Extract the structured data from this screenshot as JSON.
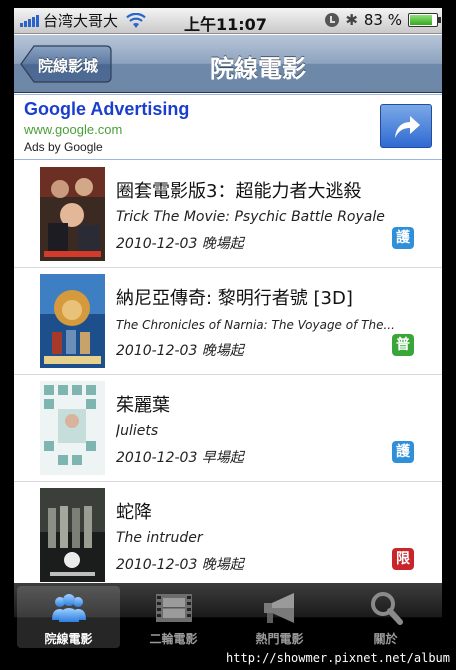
{
  "status_bar": {
    "carrier": "台湾大哥大",
    "time": "上午11:07",
    "battery_percent": "83 %",
    "battery_level": 0.83,
    "icons": [
      "signal-icon",
      "wifi-icon",
      "rotation-lock-icon",
      "bluetooth-icon",
      "battery-icon"
    ]
  },
  "nav": {
    "back_label": "院線影城",
    "title": "院線電影"
  },
  "ad": {
    "title": "Google Advertising",
    "url": "www.google.com",
    "byline": "Ads by Google",
    "button_icon": "share-arrow-icon"
  },
  "movies": [
    {
      "title": "圈套電影版3：超能力者大逃殺",
      "english": "Trick The Movie: Psychic Battle Royale",
      "date": "2010-12-03 晚場起",
      "rating": "護",
      "rating_color": "#2f8fd8"
    },
    {
      "title": "納尼亞傳奇: 黎明行者號 [3D]",
      "english": "The Chronicles of Narnia: The Voyage of The...",
      "date": "2010-12-03 晚場起",
      "rating": "普",
      "rating_color": "#3aa63a"
    },
    {
      "title": "茱麗葉",
      "english": "Juliets",
      "date": "2010-12-03 早場起",
      "rating": "護",
      "rating_color": "#2f8fd8"
    },
    {
      "title": "蛇降",
      "english": "The intruder",
      "date": "2010-12-03 晚場起",
      "rating": "限",
      "rating_color": "#c8262b"
    }
  ],
  "tabs": [
    {
      "label": "院線電影",
      "icon": "people-icon",
      "active": true
    },
    {
      "label": "二輪電影",
      "icon": "film-strip-icon",
      "active": false
    },
    {
      "label": "熱門電影",
      "icon": "megaphone-icon",
      "active": false
    },
    {
      "label": "關於",
      "icon": "magnifier-icon",
      "active": false
    }
  ],
  "watermark": "http://showmer.pixnet.net/album"
}
